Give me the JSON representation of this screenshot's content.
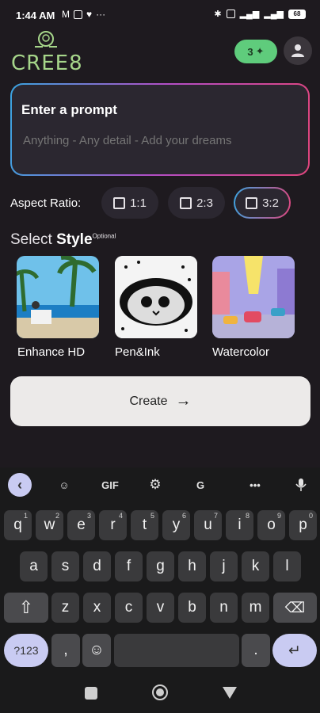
{
  "status": {
    "time": "1:44 AM",
    "battery": "68"
  },
  "header": {
    "logo_text": "CREE8",
    "credits": "3",
    "credits_icon": "sparkle-icon",
    "account_icon": "person-icon"
  },
  "prompt": {
    "title": "Enter a prompt",
    "placeholder": "Anything - Any detail - Add your dreams"
  },
  "aspect": {
    "label": "Aspect Ratio:",
    "options": [
      "1:1",
      "2:3",
      "3:2"
    ],
    "selected": "3:2"
  },
  "style": {
    "label_prefix": "Select ",
    "label_bold": "Style",
    "optional": "Optional",
    "items": [
      {
        "label": "Enhance HD"
      },
      {
        "label": "Pen&Ink"
      },
      {
        "label": "Watercolor"
      }
    ]
  },
  "create": {
    "label": "Create"
  },
  "keyboard": {
    "toolbar": {
      "gif": "GIF",
      "more": "•••"
    },
    "row1": [
      [
        "q",
        "1"
      ],
      [
        "w",
        "2"
      ],
      [
        "e",
        "3"
      ],
      [
        "r",
        "4"
      ],
      [
        "t",
        "5"
      ],
      [
        "y",
        "6"
      ],
      [
        "u",
        "7"
      ],
      [
        "i",
        "8"
      ],
      [
        "o",
        "9"
      ],
      [
        "p",
        "0"
      ]
    ],
    "row2": [
      "a",
      "s",
      "d",
      "f",
      "g",
      "h",
      "j",
      "k",
      "l"
    ],
    "row3": [
      "z",
      "x",
      "c",
      "v",
      "b",
      "n",
      "m"
    ],
    "row4": {
      "symbols": "?123",
      "comma": ",",
      "period": "."
    }
  },
  "colors": {
    "background": "#1e1a1f",
    "accent_green": "#5fcc7c",
    "logo_green": "#a6d68a",
    "gradient_blue": "#3aa4e0",
    "gradient_pink": "#e0457d"
  }
}
